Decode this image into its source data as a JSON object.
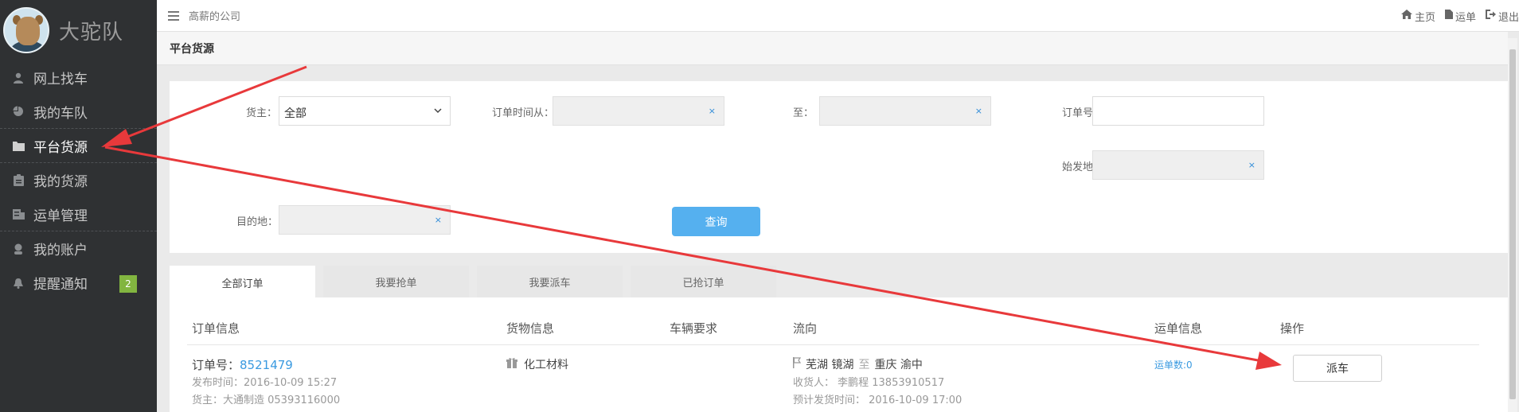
{
  "brand": {
    "name": "大驼队"
  },
  "sidebar": {
    "items": [
      {
        "label": "网上找车",
        "icon": "user-icon"
      },
      {
        "label": "我的车队",
        "icon": "pie-chart-icon"
      },
      {
        "label": "平台货源",
        "icon": "folder-icon",
        "active": true
      },
      {
        "label": "我的货源",
        "icon": "clipboard-icon"
      },
      {
        "label": "运单管理",
        "icon": "list-icon"
      },
      {
        "label": "我的账户",
        "icon": "account-icon"
      },
      {
        "label": "提醒通知",
        "icon": "bell-icon",
        "badge": "2"
      }
    ]
  },
  "topbar": {
    "company": "高薪的公司",
    "links": {
      "home": "主页",
      "waybill": "运单",
      "logout": "退出"
    }
  },
  "page": {
    "title": "平台货源"
  },
  "filters": {
    "shipper_label": "货主：",
    "shipper_value": "全部",
    "order_time_from_label": "订单时间从：",
    "to_label": "至：",
    "order_no_label": "订单号：",
    "origin_label": "始发地：",
    "destination_label": "目的地：",
    "clear_mark": "×",
    "query_button": "查询"
  },
  "tabs": [
    "全部订单",
    "我要抢单",
    "我要派车",
    "已抢订单"
  ],
  "table": {
    "headers": {
      "order_info": "订单信息",
      "cargo_info": "货物信息",
      "vehicle_req": "车辆要求",
      "flow": "流向",
      "waybill_info": "运单信息",
      "action": "操作"
    },
    "rows": [
      {
        "order_no_label": "订单号：",
        "order_no": "8521479",
        "publish_time": "发布时间：2016-10-09 15:27",
        "shipper": "货主：大通制造 05393116000",
        "cargo": "化工材料",
        "from": "芜湖 镜湖",
        "to_word": "至",
        "to": "重庆 渝中",
        "receiver": "收货人： 李鹏程 13853910517",
        "expected_ship": "预计发货时间： 2016-10-09 17:00",
        "waybill_count": "运单数:0",
        "action_label": "派车"
      }
    ]
  },
  "colors": {
    "sidebar_bg": "#2f3133",
    "accent_blue": "#55b0ef",
    "badge_green": "#82b540",
    "annotation_red": "#e8393b"
  }
}
